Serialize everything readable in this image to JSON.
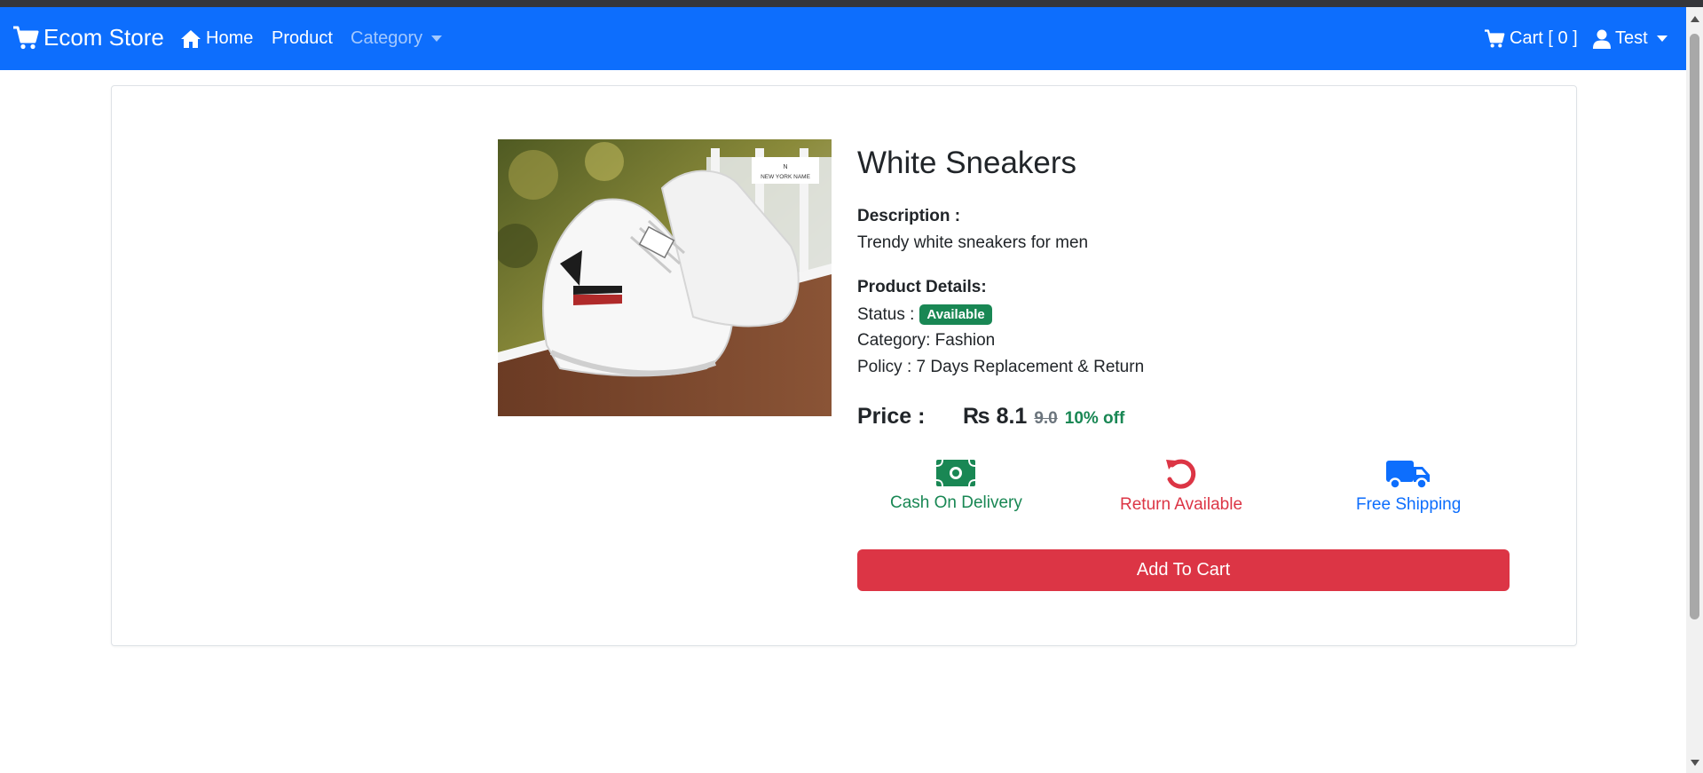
{
  "navbar": {
    "brand": "Ecom Store",
    "home": "Home",
    "product": "Product",
    "category": "Category",
    "cart": "Cart [ 0 ]",
    "user": "Test",
    "color": "#0d6efd"
  },
  "product": {
    "name": "White Sneakers",
    "image_alt": "White Sneakers",
    "image_logo_text": "NEW YORK NAME",
    "description_label": "Description :",
    "description": "Trendy white sneakers for men",
    "details_label": "Product Details:",
    "status_label": "Status :",
    "status": "Available",
    "category": "Category: Fashion",
    "policy": "Policy : 7 Days Replacement & Return",
    "price_label": "Price :",
    "price": "₨ 8.1",
    "original_price": "9.0",
    "discount": "10% off"
  },
  "features": {
    "cod": "Cash On Delivery",
    "return": "Return Available",
    "shipping": "Free Shipping"
  },
  "actions": {
    "add_to_cart": "Add To Cart"
  },
  "icons": {
    "brand": "cart-icon",
    "home": "home-icon",
    "cart": "cart-icon",
    "user": "user-icon",
    "cod": "money-bill-icon",
    "return": "undo-icon",
    "shipping": "truck-icon"
  },
  "colors": {
    "primary": "#0d6efd",
    "success": "#198754",
    "danger": "#dc3545"
  }
}
